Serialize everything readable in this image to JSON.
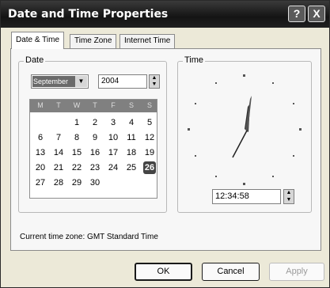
{
  "window": {
    "title": "Date and Time Properties",
    "help_glyph": "?",
    "close_glyph": "X"
  },
  "tabs": [
    {
      "label": "Date & Time",
      "active": true
    },
    {
      "label": "Time Zone",
      "active": false
    },
    {
      "label": "Internet Time",
      "active": false
    }
  ],
  "date_group": {
    "label": "Date",
    "month": "September",
    "year": "2004",
    "weekday_headers": [
      "M",
      "T",
      "W",
      "T",
      "F",
      "S",
      "S"
    ],
    "weeks": [
      [
        "",
        "",
        "1",
        "2",
        "3",
        "4",
        "5"
      ],
      [
        "6",
        "7",
        "8",
        "9",
        "10",
        "11",
        "12"
      ],
      [
        "13",
        "14",
        "15",
        "16",
        "17",
        "18",
        "19"
      ],
      [
        "20",
        "21",
        "22",
        "23",
        "24",
        "25",
        "26"
      ],
      [
        "27",
        "28",
        "29",
        "30",
        "",
        "",
        ""
      ]
    ],
    "selected_day": "26"
  },
  "time_group": {
    "label": "Time",
    "time": "12:34:58"
  },
  "timezone_text": "Current time zone:  GMT Standard Time",
  "buttons": {
    "ok": "OK",
    "cancel": "Cancel",
    "apply": "Apply"
  }
}
